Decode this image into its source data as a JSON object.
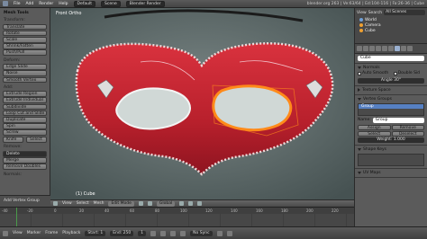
{
  "topbar": {
    "menus": [
      "File",
      "Add",
      "Render",
      "Help"
    ],
    "layout": "Default",
    "scene": "Scene",
    "engine": "Blender Render",
    "stats": "blender.org 263 | Ve:63/64 | Ed:104-116 | Fa:26-36 | Cube"
  },
  "toolshelf": {
    "header": "Mesh Tools",
    "transform_label": "Transform:",
    "transform": [
      "Translate",
      "Rotate",
      "Scale",
      "Shrink/Fatten",
      "Push/Pull"
    ],
    "deform_label": "Deform:",
    "deform": [
      "Edge Slide",
      "Noise",
      "Smooth Vertex"
    ],
    "add_label": "Add:",
    "add": [
      "Extrude Region",
      "Extrude Individual",
      "Subdivide",
      "Loop Cut and Slide",
      "Duplicate",
      "Spin",
      "Screw"
    ],
    "knife": "Knife",
    "select": "Select",
    "remove_label": "Remove:",
    "delete": "Delete",
    "merge": "Merge",
    "remove_doubles": "Remove Doubles",
    "normals_label": "Normals:",
    "operator_panel": "Add Vertex Group"
  },
  "viewport": {
    "view_label": "Front Ortho",
    "object_label": "(1) Cube"
  },
  "vp_header": {
    "view": "View",
    "select": "Select",
    "mesh": "Mesh",
    "mode": "Edit Mode",
    "pivot": "Global"
  },
  "outliner": {
    "view": "View",
    "search": "Search",
    "scope": "All Scenes",
    "items": [
      "World",
      "Camera",
      "Cube"
    ]
  },
  "properties": {
    "object_name": "Cube",
    "normals_header": "Normals",
    "auto_smooth": "Auto Smooth",
    "double_sided": "Double Sid",
    "angle": "Angle 30°",
    "texture_space": "Texture Space",
    "vertex_groups": "Vertex Groups",
    "group_name": "Group",
    "name_label": "Name:",
    "name_value": "Group",
    "assign": "Assign",
    "remove": "Remove",
    "select": "Select",
    "deselect": "Deselect",
    "weight": "Weight: 1.000",
    "shape_keys": "Shape Keys",
    "uv_maps": "UV Maps"
  },
  "timeline": {
    "ticks": [
      "-40",
      "-20",
      "0",
      "20",
      "40",
      "60",
      "80",
      "100",
      "120",
      "140",
      "160",
      "180",
      "200",
      "220"
    ]
  },
  "bottombar": {
    "view": "View",
    "marker": "Marker",
    "frame": "Frame",
    "playback": "Playback",
    "start": "Start: 1",
    "end": "End: 250",
    "current": "1",
    "sync": "No Sync"
  }
}
